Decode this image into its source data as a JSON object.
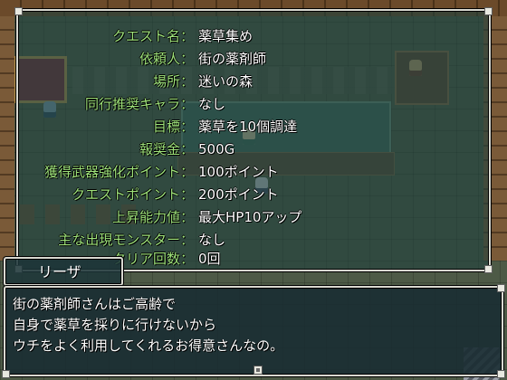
{
  "quest": {
    "rows": [
      {
        "label": "クエスト名",
        "value": "薬草集め"
      },
      {
        "label": "依頼人",
        "value": "街の薬剤師"
      },
      {
        "label": "場所",
        "value": "迷いの森"
      },
      {
        "label": "同行推奨キャラ",
        "value": "なし"
      },
      {
        "label": "目標",
        "value": "薬草を10個調達"
      },
      {
        "label": "報奨金",
        "value": "500G"
      },
      {
        "label": "獲得武器強化ポイント",
        "value": "100ポイント"
      },
      {
        "label": "クエストポイント",
        "value": "200ポイント"
      },
      {
        "label": "上昇能力値",
        "value": "最大HP10アップ"
      },
      {
        "label": "主な出現モンスター",
        "value": "なし"
      },
      {
        "label": "クリア回数",
        "value": "0回"
      }
    ]
  },
  "dialogue": {
    "speaker": "リーザ",
    "lines": [
      "街の薬剤師さんはご高齢で",
      "自身で薬草を採りに行けないから",
      "ウチをよく利用してくれるお得意さんなの。"
    ]
  },
  "colors": {
    "label": "#9ee27a",
    "value": "#ffffff",
    "window_border": "#d8d8d0",
    "window_fill": "#20403e"
  },
  "icons": {
    "advance": "message-advance-icon"
  }
}
